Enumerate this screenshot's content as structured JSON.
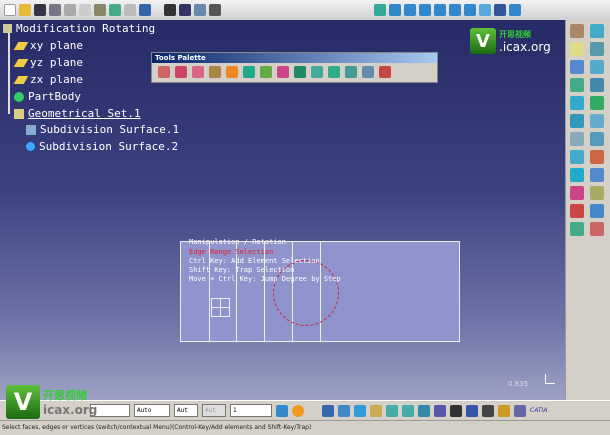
{
  "tree": {
    "root": "Modification Rotating",
    "items": [
      "xy plane",
      "yz plane",
      "zx plane",
      "PartBody",
      "Geometrical Set.1",
      "Subdivision Surface.1",
      "Subdivision Surface.2"
    ]
  },
  "tools_palette": {
    "title": "Tools Palette"
  },
  "overlay": {
    "line1": "Manipulation / Rotation",
    "line2": "Edge Range Selection",
    "line3": "Ctrl Key: Add Element Selection",
    "line4": "Shift Key: Trap Selection",
    "line5": "Move + Ctrl Key: Jump Degree by Step"
  },
  "viewport": {
    "scale": "0.835"
  },
  "bottom_toolbar": {
    "selects": [
      "Auto",
      "Aut",
      "Aut",
      "1"
    ]
  },
  "status": "Select faces, edges or vertices (switch/contextual Menu)(Control-Key/Add elements and Shift-Key/Trap)",
  "watermark": {
    "letter": "V",
    "site": ".icax.org",
    "site2": "icax.org",
    "cn": "开思视频"
  },
  "brand": "CATIA"
}
